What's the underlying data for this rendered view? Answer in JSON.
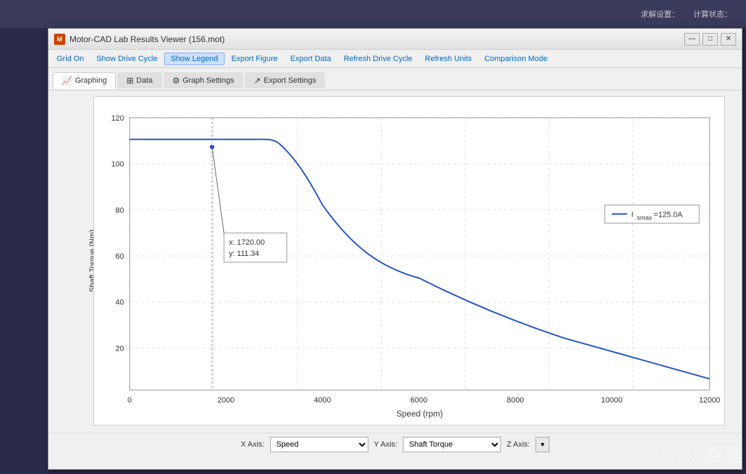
{
  "window": {
    "title": "Motor-CAD Lab Results Viewer (156.mot)",
    "icon_label": "M"
  },
  "titlebar_buttons": {
    "minimize": "—",
    "maximize": "□",
    "close": "✕"
  },
  "menubar": {
    "items": [
      {
        "label": "Grid On",
        "active": false
      },
      {
        "label": "Show Drive Cycle",
        "active": false
      },
      {
        "label": "Show Legend",
        "active": true
      },
      {
        "label": "Export Figure",
        "active": false
      },
      {
        "label": "Export Data",
        "active": false
      },
      {
        "label": "Refresh Drive Cycle",
        "active": false
      },
      {
        "label": "Refresh Units",
        "active": false
      },
      {
        "label": "Comparison Mode",
        "active": false
      }
    ]
  },
  "tabs": [
    {
      "label": "Graphing",
      "icon": "📈",
      "active": true
    },
    {
      "label": "Data",
      "icon": "⊞",
      "active": false
    },
    {
      "label": "Graph Settings",
      "icon": "⚙",
      "active": false
    },
    {
      "label": "Export Settings",
      "icon": "↗",
      "active": false
    }
  ],
  "chart": {
    "y_axis_label": "Shaft Torque (Nm)",
    "x_axis_label": "Speed (rpm)",
    "y_max": 120,
    "y_min": 20,
    "x_max": 12000,
    "x_min": 0,
    "y_ticks": [
      "120",
      "100",
      "80",
      "60",
      "40",
      "20"
    ],
    "x_ticks": [
      "0",
      "2000",
      "4000",
      "6000",
      "8000",
      "10000",
      "12000"
    ],
    "legend_text": "I",
    "legend_subscript": "smax",
    "legend_value": "=125.0A",
    "tooltip": {
      "x_label": "x:",
      "x_value": "1720.00",
      "y_label": "y:",
      "y_value": "111.34"
    }
  },
  "axis_controls": {
    "x_axis_label": "X Axis:",
    "x_axis_value": "Speed",
    "y_axis_label": "Y Axis:",
    "y_axis_value": "Shaft Torque",
    "z_axis_label": "Z Axis:"
  },
  "desktop": {
    "top_text": "求解设置：",
    "right_text": "计算状态："
  },
  "watermark": "simol 西莫"
}
